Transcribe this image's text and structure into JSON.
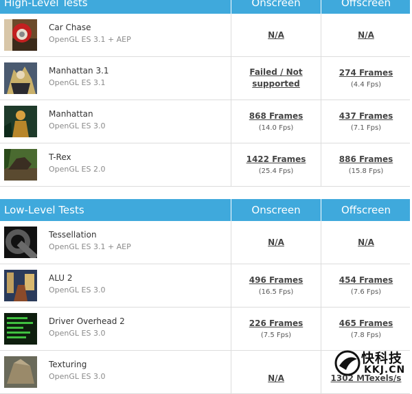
{
  "high": {
    "title": "High-Level Tests",
    "col1": "Onscreen",
    "col2": "Offscreen",
    "rows": [
      {
        "name": "Car Chase",
        "api": "OpenGL ES 3.1 + AEP",
        "on": "N/A",
        "on_fps": "",
        "off": "N/A",
        "off_fps": ""
      },
      {
        "name": "Manhattan 3.1",
        "api": "OpenGL ES 3.1",
        "on": "Failed / Not supported",
        "on_fps": "",
        "off": "274 Frames",
        "off_fps": "(4.4 Fps)"
      },
      {
        "name": "Manhattan",
        "api": "OpenGL ES 3.0",
        "on": "868 Frames",
        "on_fps": "(14.0 Fps)",
        "off": "437 Frames",
        "off_fps": "(7.1 Fps)"
      },
      {
        "name": "T-Rex",
        "api": "OpenGL ES 2.0",
        "on": "1422 Frames",
        "on_fps": "(25.4 Fps)",
        "off": "886 Frames",
        "off_fps": "(15.8 Fps)"
      }
    ]
  },
  "low": {
    "title": "Low-Level Tests",
    "col1": "Onscreen",
    "col2": "Offscreen",
    "rows": [
      {
        "name": "Tessellation",
        "api": "OpenGL ES 3.1 + AEP",
        "on": "N/A",
        "on_fps": "",
        "off": "N/A",
        "off_fps": ""
      },
      {
        "name": "ALU 2",
        "api": "OpenGL ES 3.0",
        "on": "496 Frames",
        "on_fps": "(16.5 Fps)",
        "off": "454 Frames",
        "off_fps": "(7.6 Fps)"
      },
      {
        "name": "Driver Overhead 2",
        "api": "OpenGL ES 3.0",
        "on": "226 Frames",
        "on_fps": "(7.5 Fps)",
        "off": "465 Frames",
        "off_fps": "(7.8 Fps)"
      },
      {
        "name": "Texturing",
        "api": "OpenGL ES 3.0",
        "on": "N/A",
        "on_fps": "",
        "off": "1302 MTexels/s",
        "off_fps": ""
      }
    ]
  },
  "watermark": {
    "text": "快科技",
    "sub": "KKJ.CN"
  },
  "colors": {
    "header": "#3fa9dc"
  }
}
